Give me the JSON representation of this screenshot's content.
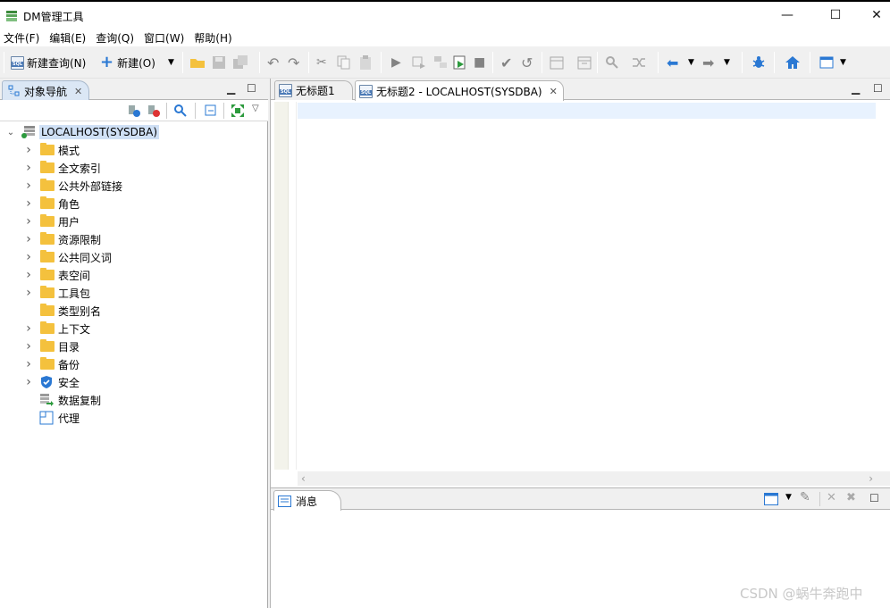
{
  "window": {
    "title": "DM管理工具",
    "minimize": "—",
    "maximize": "☐",
    "close": "✕"
  },
  "menu": [
    "文件(F)",
    "编辑(E)",
    "查询(Q)",
    "窗口(W)",
    "帮助(H)"
  ],
  "toolbar": {
    "new_query_label": "新建查询(N)",
    "new_label": "新建(O)"
  },
  "navigator": {
    "tab_label": "对象导航",
    "root": "LOCALHOST(SYSDBA)",
    "items": [
      {
        "label": "模式",
        "icon": "folder-icon",
        "expandable": true
      },
      {
        "label": "全文索引",
        "icon": "folder-icon",
        "expandable": true
      },
      {
        "label": "公共外部链接",
        "icon": "folder-icon",
        "expandable": true
      },
      {
        "label": "角色",
        "icon": "folder-icon",
        "expandable": true
      },
      {
        "label": "用户",
        "icon": "folder-icon",
        "expandable": true
      },
      {
        "label": "资源限制",
        "icon": "folder-icon",
        "expandable": true
      },
      {
        "label": "公共同义词",
        "icon": "folder-icon",
        "expandable": true
      },
      {
        "label": "表空间",
        "icon": "folder-icon",
        "expandable": true
      },
      {
        "label": "工具包",
        "icon": "folder-icon",
        "expandable": true
      },
      {
        "label": "类型别名",
        "icon": "folder-icon",
        "expandable": false
      },
      {
        "label": "上下文",
        "icon": "folder-icon",
        "expandable": true
      },
      {
        "label": "目录",
        "icon": "folder-icon",
        "expandable": true
      },
      {
        "label": "备份",
        "icon": "folder-icon",
        "expandable": true
      },
      {
        "label": "安全",
        "icon": "shield-icon",
        "expandable": true
      },
      {
        "label": "数据复制",
        "icon": "replication-icon",
        "expandable": false
      },
      {
        "label": "代理",
        "icon": "agent-icon",
        "expandable": false
      }
    ]
  },
  "editor": {
    "tabs": [
      {
        "label": "无标题1",
        "active": false
      },
      {
        "label": "无标题2 - LOCALHOST(SYSDBA)",
        "active": true
      }
    ]
  },
  "messages": {
    "tab_label": "消息"
  },
  "watermark": "CSDN @蜗牛奔跑中",
  "colors": {
    "selection": "#cfe0f5",
    "folder": "#f4c13d",
    "current_line": "#e8f2fe",
    "accent_blue": "#2a78d3"
  }
}
